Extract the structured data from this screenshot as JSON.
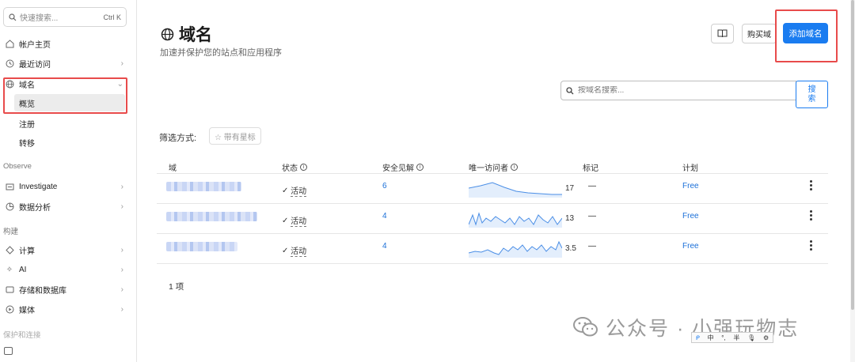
{
  "sidebar": {
    "search_placeholder": "快速搜索...",
    "search_shortcut": "Ctrl K",
    "items": [
      {
        "label": "帐户主页"
      },
      {
        "label": "最近访问"
      },
      {
        "label": "域名"
      },
      {
        "label": "Investigate"
      },
      {
        "label": "数据分析"
      },
      {
        "label": "计算"
      },
      {
        "label": "AI"
      },
      {
        "label": "存储和数据库"
      },
      {
        "label": "媒体"
      }
    ],
    "sub_items": [
      {
        "label": "概览"
      },
      {
        "label": "注册"
      },
      {
        "label": "转移"
      }
    ],
    "sections": [
      "Observe",
      "构建",
      "保护和连接"
    ]
  },
  "header": {
    "title": "域名",
    "subtitle": "加速并保护您的站点和应用程序",
    "buy_label": "购买域",
    "add_label": "添加域名"
  },
  "domain_search": {
    "placeholder": "按域名搜索...",
    "button_label": "搜索"
  },
  "filter": {
    "label": "筛选方式:",
    "chip": "☆ 带有星标"
  },
  "table": {
    "columns": [
      "域",
      "状态",
      "安全见解",
      "唯一访问者",
      "标记",
      "计划"
    ],
    "rows": [
      {
        "status": "活动",
        "insights": "6",
        "visitors": "17",
        "tags": "—",
        "plan": "Free"
      },
      {
        "status": "活动",
        "insights": "4",
        "visitors": "13",
        "tags": "—",
        "plan": "Free"
      },
      {
        "status": "活动",
        "insights": "4",
        "visitors": "3.5",
        "tags": "—",
        "plan": "Free"
      }
    ],
    "count": "1 项"
  },
  "watermark": "公众号 · 小强玩物志",
  "ime": [
    "中",
    "°,",
    "半",
    "🎙",
    "⚙"
  ],
  "colors": {
    "accent": "#1a7cf0",
    "highlight": "#e84b4b"
  }
}
